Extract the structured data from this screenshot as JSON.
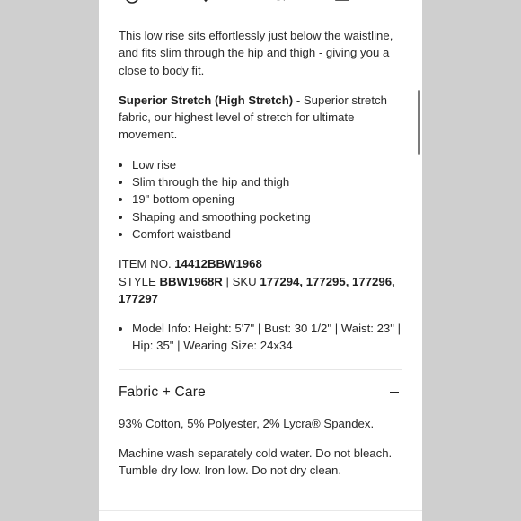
{
  "description": {
    "intro": "This low rise sits effortlessly just below the waistline, and fits slim through the hip and thigh - giving you a close to body fit.",
    "stretch_label": "Superior Stretch (High Stretch)",
    "stretch_text": " - Superior stretch fabric, our highest level of stretch for ultimate movement.",
    "features": [
      "Low rise",
      "Slim through the hip and thigh",
      "19\" bottom opening",
      "Shaping and smoothing pocketing",
      "Comfort waistband"
    ]
  },
  "identifiers": {
    "item_label": "ITEM NO.",
    "item_value": "14412BBW1968",
    "style_label": "STYLE",
    "style_value": "BBW1968R",
    "sku_label": "| SKU",
    "sku_value": "177294, 177295, 177296, 177297"
  },
  "model_info": "Model Info: Height: 5'7\" | Bust: 30 1/2\" | Waist: 23\" | Hip: 35\" | Wearing Size: 24x34",
  "fabric_care": {
    "title": "Fabric + Care",
    "composition": "93% Cotton, 5% Polyester, 2% Lycra® Spandex.",
    "care": "Machine wash separately cold water. Do not bleach. Tumble dry low. Iron low. Do not dry clean."
  },
  "icons": [
    "account-icon",
    "heart-icon",
    "search-icon",
    "bag-icon"
  ]
}
